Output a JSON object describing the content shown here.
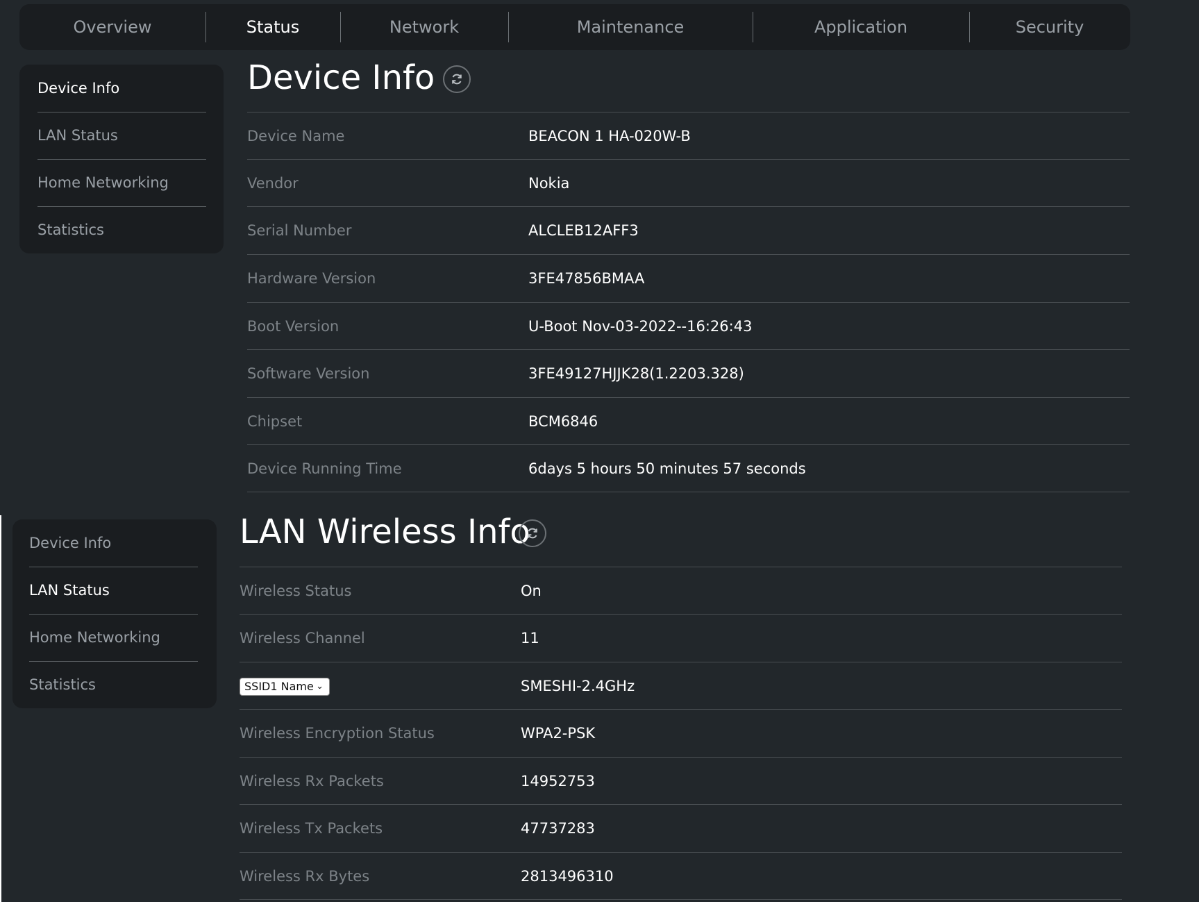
{
  "nav": {
    "items": [
      {
        "label": "Overview"
      },
      {
        "label": "Status"
      },
      {
        "label": "Network"
      },
      {
        "label": "Maintenance"
      },
      {
        "label": "Application"
      },
      {
        "label": "Security"
      }
    ],
    "active": "Status"
  },
  "sidebar": {
    "items": [
      {
        "label": "Device Info"
      },
      {
        "label": "LAN Status"
      },
      {
        "label": "Home Networking"
      },
      {
        "label": "Statistics"
      }
    ]
  },
  "device_info": {
    "title": "Device Info",
    "rows": [
      {
        "label": "Device Name",
        "value": "BEACON 1 HA-020W-B"
      },
      {
        "label": "Vendor",
        "value": "Nokia"
      },
      {
        "label": "Serial Number",
        "value": "ALCLEB12AFF3"
      },
      {
        "label": "Hardware Version",
        "value": "3FE47856BMAA"
      },
      {
        "label": "Boot Version",
        "value": "U-Boot Nov-03-2022--16:26:43"
      },
      {
        "label": "Software Version",
        "value": "3FE49127HJJK28(1.2203.328)"
      },
      {
        "label": "Chipset",
        "value": "BCM6846"
      },
      {
        "label": "Device Running Time",
        "value": "6days 5 hours 50 minutes 57 seconds"
      }
    ]
  },
  "lan_wireless_info": {
    "title": "LAN Wireless Info",
    "ssid_select": "SSID1 Name",
    "rows": [
      {
        "label": "Wireless Status",
        "value": "On"
      },
      {
        "label": "Wireless Channel",
        "value": "11"
      },
      {
        "label": "",
        "value": "SMESHI-2.4GHz"
      },
      {
        "label": "Wireless Encryption Status",
        "value": "WPA2-PSK"
      },
      {
        "label": "Wireless Rx Packets",
        "value": "14952753"
      },
      {
        "label": "Wireless Tx Packets",
        "value": "47737283"
      },
      {
        "label": "Wireless Rx Bytes",
        "value": "2813496310"
      }
    ]
  },
  "colors": {
    "background": "#22272b",
    "panel": "#1a1d20",
    "label": "#7d8388",
    "value": "#ffffff"
  }
}
